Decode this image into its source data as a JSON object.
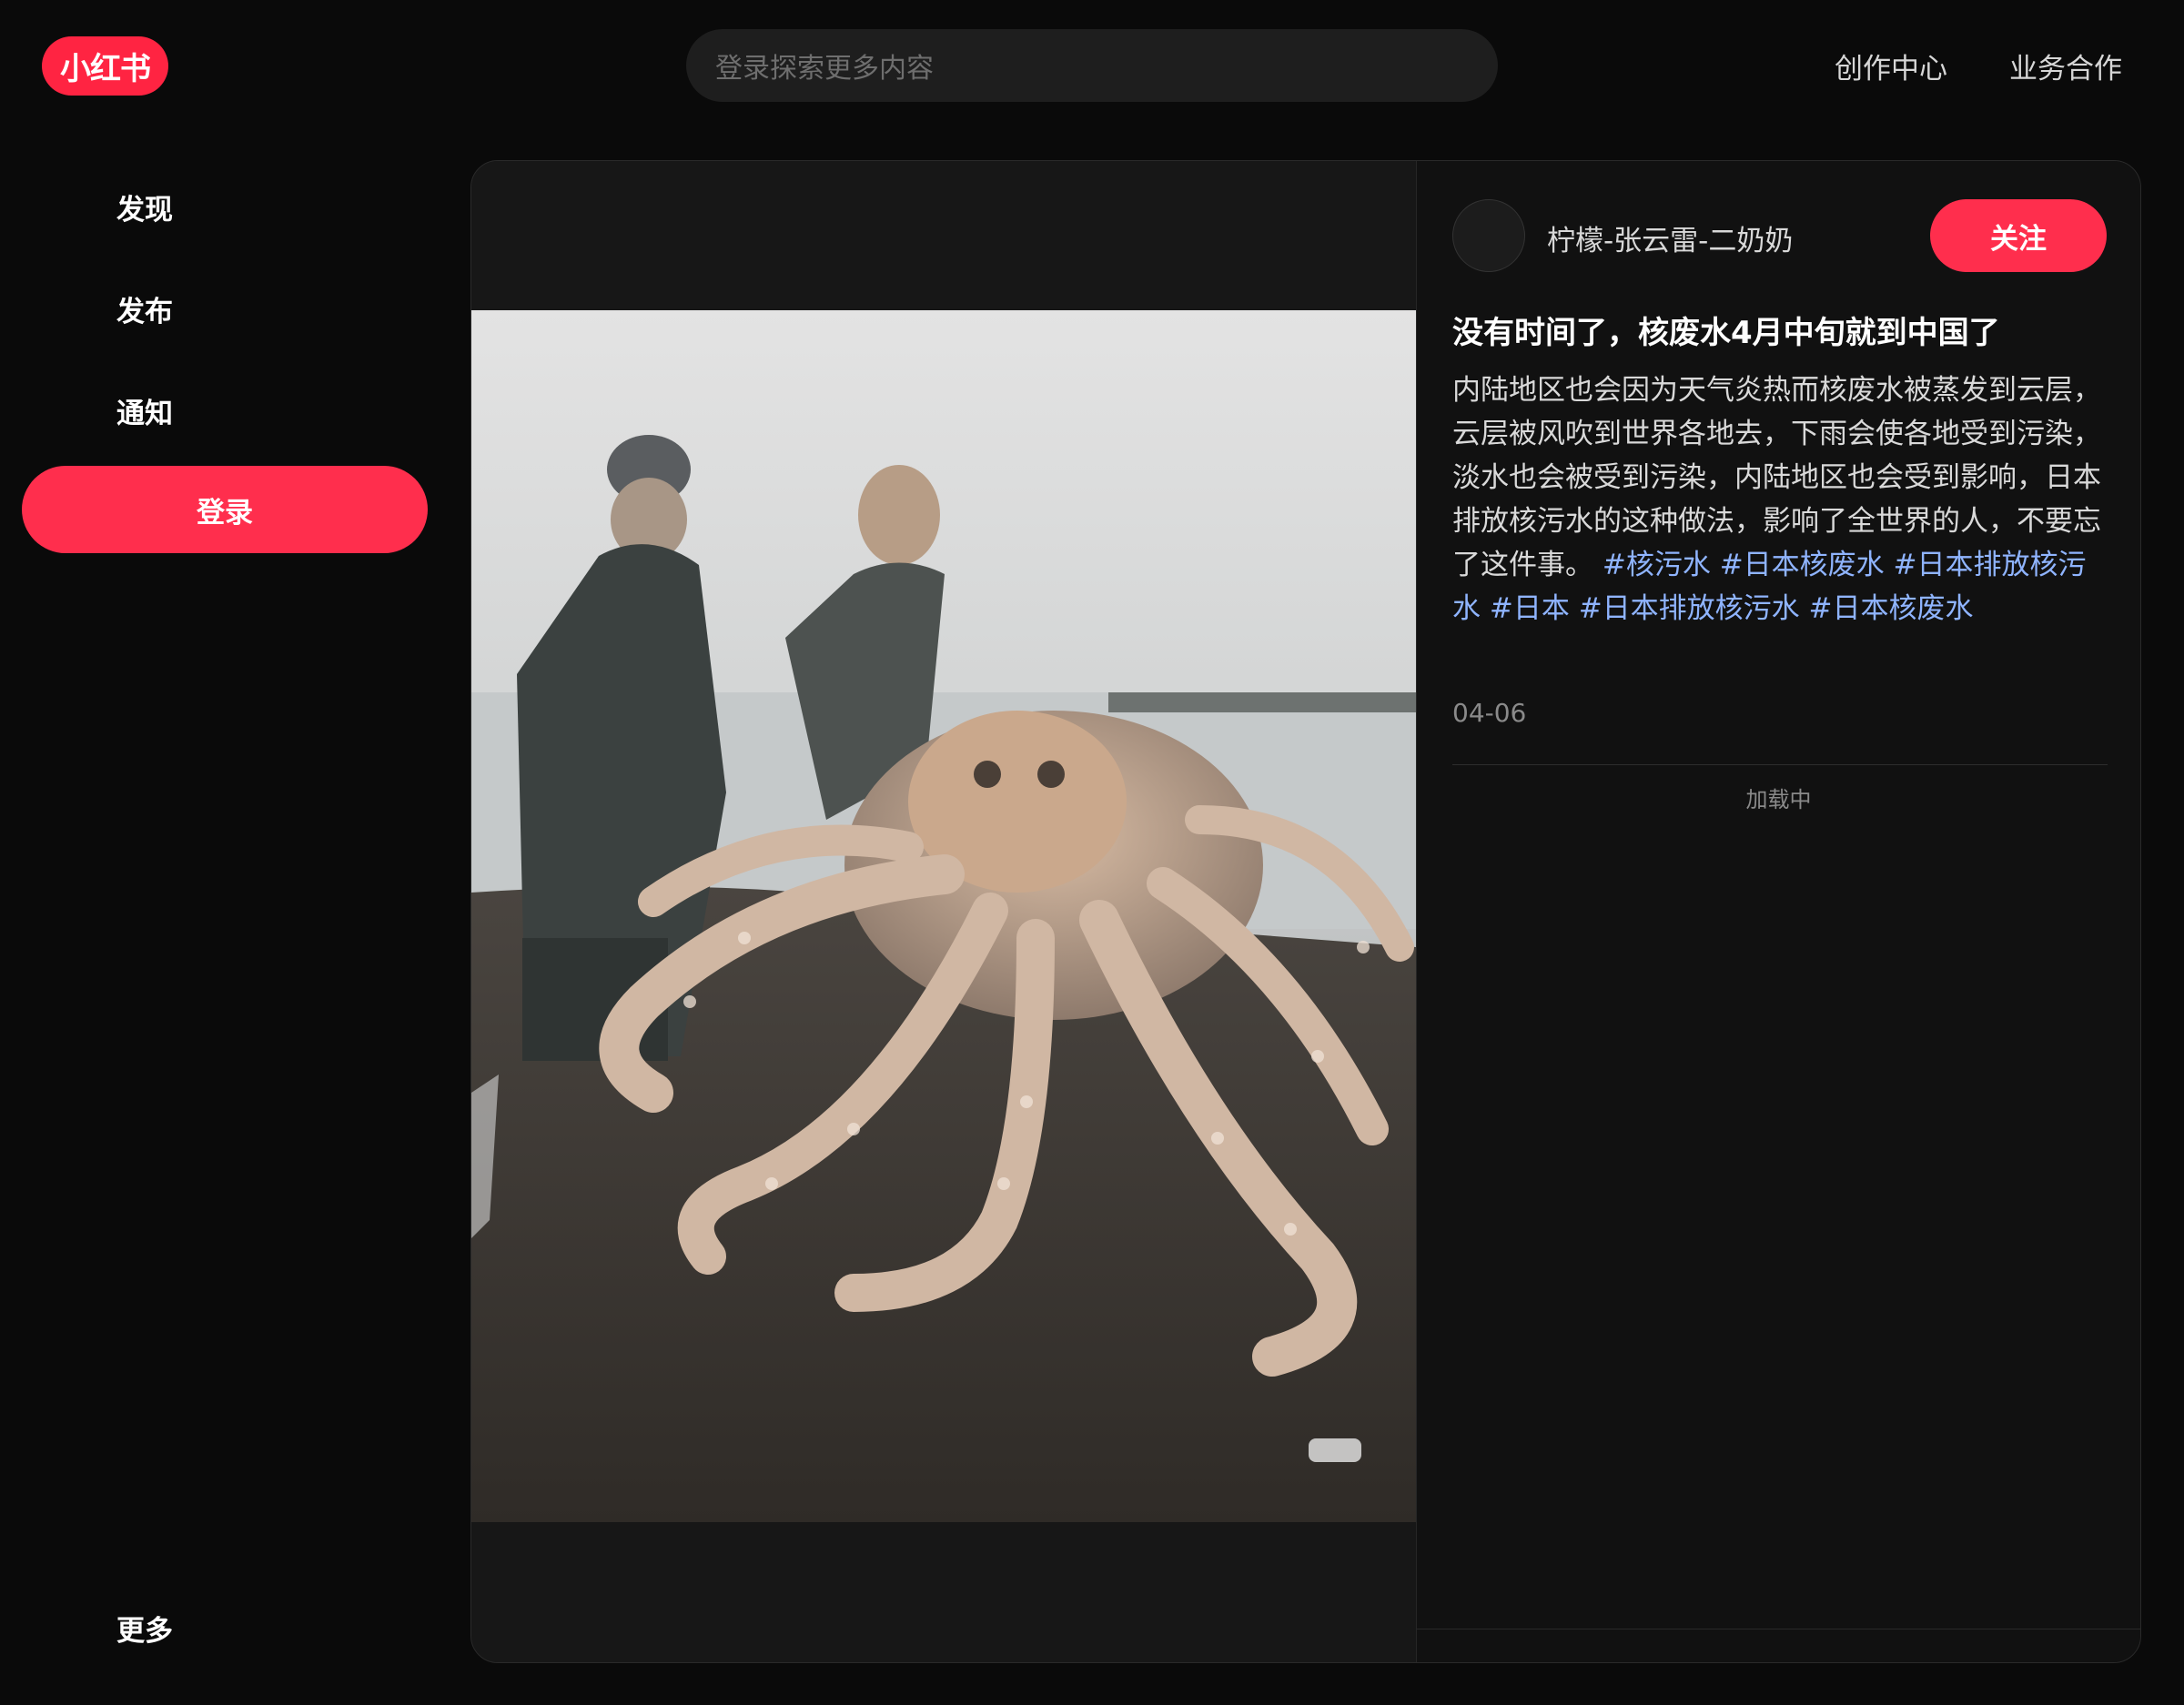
{
  "brand": {
    "logo_text": "小红书",
    "accent": "#ff2442"
  },
  "header": {
    "search_placeholder": "登录探索更多内容",
    "links": [
      "创作中心",
      "业务合作"
    ]
  },
  "sidebar": {
    "items": [
      {
        "label": "发现"
      },
      {
        "label": "发布"
      },
      {
        "label": "通知"
      }
    ],
    "login_label": "登录",
    "more_label": "更多"
  },
  "note": {
    "author": "柠檬-张云雷-二奶奶",
    "follow_label": "关注",
    "title": "没有时间了，核废水4月中旬就到中国了",
    "body": "内陆地区也会因为天气炎热而核废水被蒸发到云层，云层被风吹到世界各地去，下雨会使各地受到污染，淡水也会被受到污染，内陆地区也会受到影响，日本排放核污水的这种做法，影响了全世界的人，不要忘了这件事。",
    "tags": [
      "#核污水",
      "#日本核废水",
      "#日本排放核污水",
      "#日本",
      "#日本排放核污水",
      "#日本核废水"
    ],
    "date": "04-06",
    "loading_text": "加载中"
  }
}
